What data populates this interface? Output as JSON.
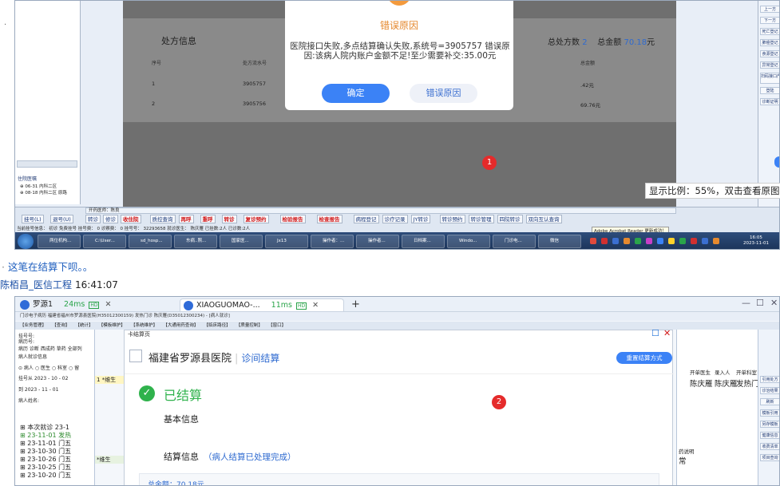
{
  "shot1": {
    "dialog": {
      "title": "错误原因",
      "message": "医院接口失败,多点结算确认失败,系统号=3905757 错误原因:该病人院内账户金额不足!至少需要补交:35.00元",
      "ok_label": "确定",
      "reason_label": "错误原因",
      "accent": "#e5892f"
    },
    "rx": {
      "title": "处方信息",
      "total_count_label": "总处方数",
      "total_count": "2",
      "total_amount_label": "总金额",
      "total_amount": "70.18",
      "currency": "元",
      "headers": [
        "序号",
        "处方流水号",
        "总金额"
      ],
      "rows": [
        {
          "no": "1",
          "serial": "3905757",
          "amount": ".42元"
        },
        {
          "no": "2",
          "serial": "3905756",
          "amount": "69.76元"
        }
      ]
    },
    "marker": "1",
    "left_tree": {
      "title": "住院医嘱",
      "items": [
        "⊕ 06-31 内科二区",
        "⊕ 08-18 内科二区 原路"
      ]
    },
    "right_buttons": [
      "上一方",
      "下一方",
      "死亡登记",
      "肺癌登记",
      "食源登记",
      "异常登记",
      "扫码接口产科检查",
      "登陆",
      "诊断证明"
    ],
    "bottom_buttons": [
      {
        "label": "转诊",
        "red": false
      },
      {
        "label": "修诊",
        "red": false
      },
      {
        "label": "收住院",
        "red": true
      },
      {
        "label": "质控查询",
        "red": false
      },
      {
        "label": "再呼",
        "red": true
      },
      {
        "label": "重呼",
        "red": true
      },
      {
        "label": "转诊",
        "red": true
      },
      {
        "label": "复诊预约",
        "red": true
      },
      {
        "label": "检验报告",
        "red": true
      },
      {
        "label": "检查报告",
        "red": true
      },
      {
        "label": "病程登记",
        "red": false
      },
      {
        "label": "诊疗记录",
        "red": false
      },
      {
        "label": "JY转诊",
        "red": false
      },
      {
        "label": "转诊预约",
        "red": false
      },
      {
        "label": "转诊管理",
        "red": false
      },
      {
        "label": "四院转诊",
        "red": false
      },
      {
        "label": "双向互认查询",
        "red": false
      }
    ],
    "left_small_buttons": [
      "挂号(L)",
      "退号(U)"
    ],
    "stripe_label": "开药医师：陈良",
    "status_text": "当前挂号信息： 初诊 免费挂号     挂号费： 0     诊察费： 0     挂号号： 32293658     就诊医生： 陈庆雁     已挂数:2人  已诊数:2人",
    "tooltip": "Adobe Acrobat Reader 更新成功！",
    "taskbar": [
      "两位机构...",
      "C:\\User...",
      "sd_hosp...",
      "东病..照...",
      "国家医...",
      "Jx13",
      "操作者：...",
      "操作者...",
      "日档案...",
      "Windo...",
      "门诊电...",
      "微信"
    ],
    "clock_time": "16:05",
    "clock_date": "2023-11-01"
  },
  "chat": {
    "message": "这笔在结算下呗。。",
    "sender": "陈栢昌_医信工程",
    "time": "16:41:07"
  },
  "shot2": {
    "tabs": [
      {
        "name": "罗源1",
        "ping": "24ms"
      },
      {
        "name": "XIAOGUOMAO-...",
        "ping": "11ms"
      }
    ],
    "hd_label": "HD",
    "app_title": "门诊电子病历  福建省福州市罗源县医院(H35012300159)  发热门诊  陈庆雁(D35012300234) - [病人就诊]",
    "menu": [
      "【业务管理】",
      "【查询】",
      "【统计】",
      "【模板维护】",
      "【系统维护】",
      "【大通用药查询】",
      "【临床路径】",
      "【质量控制】",
      "【窗口】"
    ],
    "left_labels": [
      "挂号号:",
      "病历号:",
      "病历  诊断  西成药  草药  全部列",
      "病人就诊信息",
      "⊙ 病人 ○ 医生 ○ 科室 ○ 留",
      "挂号从 2023 - 10 - 02",
      "到 2023 - 11 - 01",
      "病人姓名:"
    ],
    "visit_tree": [
      {
        "text": "⊞ 本次就诊 23-1",
        "green": false
      },
      {
        "text": "⊞ 23-11-01 发热",
        "green": true
      },
      {
        "text": "⊞ 23-11-01 门五",
        "green": false
      },
      {
        "text": "⊞ 23-10-30 门五",
        "green": false
      },
      {
        "text": "⊞ 23-10-26 门五",
        "green": false
      },
      {
        "text": "⊞ 23-10-25 门五",
        "green": false
      },
      {
        "text": "⊞ 23-10-20 门五",
        "green": false
      }
    ],
    "mid_row": "1 *维生",
    "mid_row2": "*维生",
    "modal": {
      "window_title": "卡结算页",
      "hospital": "福建省罗源县医院",
      "subtitle": "诊间结算",
      "reset_label": "重置结算方式",
      "status": "已结算",
      "basic_info": "基本信息",
      "settle_info": "结算信息",
      "settle_note": "（病人结算已处理完成）",
      "total_label": "总金额：70.18元"
    },
    "marker": "2",
    "right_headers": [
      "开单医生",
      "录入人",
      "开单科室"
    ],
    "right_values": [
      "陈庆雁",
      "陈庆雁",
      "发热门"
    ],
    "right_tail": [
      "药说明",
      "常"
    ],
    "right_buttons": [
      "引用处方",
      "诊治结果",
      "刷新",
      "模板引用",
      "另存模板",
      "健康信息",
      "收费清单",
      "项目查询"
    ],
    "zoom_tip": "显示比例：55%，双击查看原图"
  }
}
